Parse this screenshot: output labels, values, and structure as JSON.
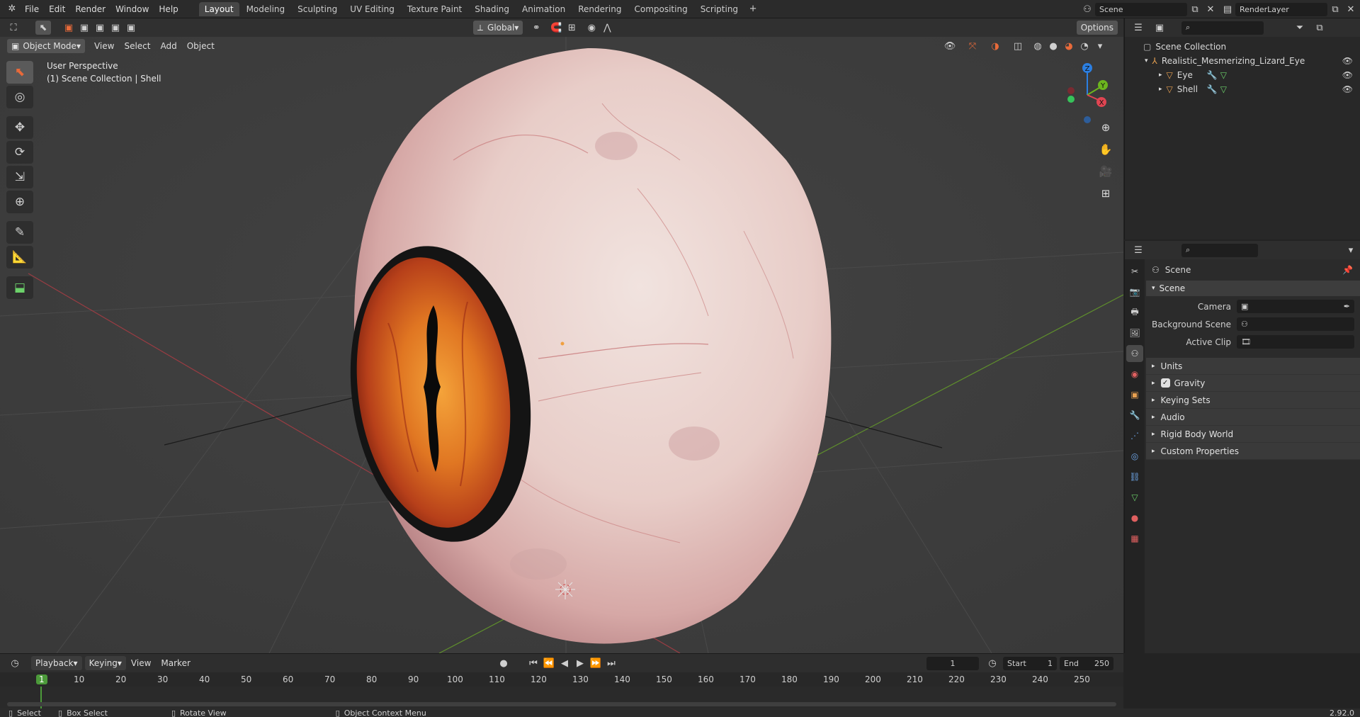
{
  "topbar": {
    "menus": [
      "File",
      "Edit",
      "Render",
      "Window",
      "Help"
    ],
    "workspaces": [
      "Layout",
      "Modeling",
      "Sculpting",
      "UV Editing",
      "Texture Paint",
      "Shading",
      "Animation",
      "Rendering",
      "Compositing",
      "Scripting"
    ],
    "scene": "Scene",
    "view_layer": "RenderLayer"
  },
  "viewport": {
    "orientation": "Global",
    "options_label": "Options",
    "mode": "Object Mode",
    "menus": [
      "View",
      "Select",
      "Add",
      "Object"
    ],
    "info_line1": "User Perspective",
    "info_line2": "(1) Scene Collection | Shell",
    "gizmo_axes": [
      "Z",
      "Y",
      "X"
    ],
    "colors": {
      "x": "#e04552",
      "y": "#6cb51e",
      "z": "#2b7fe2",
      "iris": "#d4541a",
      "sclera": "#ead3cd"
    }
  },
  "outliner": {
    "root": "Scene Collection",
    "collection": "Realistic_Mesmerizing_Lizard_Eye",
    "objects": [
      "Eye",
      "Shell"
    ]
  },
  "properties": {
    "context": "Scene",
    "panel": "Scene",
    "camera_label": "Camera",
    "background_label": "Background Scene",
    "clip_label": "Active Clip",
    "subpanels": [
      "Units",
      "Gravity",
      "Keying Sets",
      "Audio",
      "Rigid Body World",
      "Custom Properties"
    ],
    "gravity_enabled": true
  },
  "timeline": {
    "menus": [
      "Playback",
      "Keying",
      "View",
      "Marker"
    ],
    "current_frame": "1",
    "start_label": "Start",
    "start": "1",
    "end_label": "End",
    "end": "250",
    "ticks": [
      "1",
      "10",
      "20",
      "30",
      "40",
      "50",
      "60",
      "70",
      "80",
      "90",
      "100",
      "110",
      "120",
      "130",
      "140",
      "150",
      "160",
      "170",
      "180",
      "190",
      "200",
      "210",
      "220",
      "230",
      "240",
      "250"
    ]
  },
  "statusbar": {
    "select": "Select",
    "box_select": "Box Select",
    "rotate": "Rotate View",
    "context_menu": "Object Context Menu",
    "version": "2.92.0"
  }
}
